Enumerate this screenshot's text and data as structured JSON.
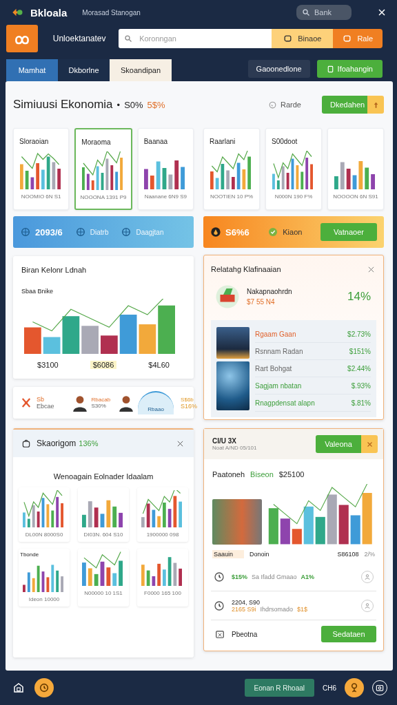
{
  "top_bar": {
    "app_name": "Bkloala",
    "subtitle": "Morasad Stanogan",
    "search": {
      "placeholder": "Bank"
    }
  },
  "header": {
    "title": "Unloektanatev",
    "search": {
      "placeholder": "Koronngan"
    },
    "buttons": [
      {
        "label": "Binaoe",
        "kind": "light"
      },
      {
        "label": "Rale",
        "kind": "accent"
      }
    ]
  },
  "tabs": [
    {
      "label": "Mamhat",
      "selected": true,
      "kind": "dark"
    },
    {
      "label": "Dkborlne",
      "selected": false,
      "kind": "dark"
    },
    {
      "label": "Skoandipan",
      "selected": false,
      "kind": "light"
    }
  ],
  "tab_actions": [
    {
      "label": "Gaoonedlone",
      "kind": "dark"
    },
    {
      "label": "Ifoahangin",
      "kind": "primary"
    }
  ],
  "page": {
    "title": "Simiuusi Ekonomia",
    "separator": "•",
    "stat": "S0%",
    "change": "5$%",
    "filter": "Rarde",
    "action": "Dkedahen"
  },
  "mini_charts": [
    {
      "title": "Sloraoian",
      "caption": "NOOMIO 6N S1",
      "selected": false
    },
    {
      "title": "Moraoma",
      "caption": "NOOONA 1391 P9",
      "selected": true
    },
    {
      "title": "Baanaa",
      "caption": "Naanane 6N9 S9",
      "selected": false
    },
    {
      "title": "Raarlani",
      "caption": "NOOTIEN 10 P%",
      "selected": false
    },
    {
      "title": "S00doot",
      "caption": "N000N 190 F%",
      "selected": false
    },
    {
      "caption": "NOOOON 6N S91",
      "selected": false
    }
  ],
  "blue_strip": {
    "items": [
      "2093/6",
      "Diatrb",
      "Daagjtan"
    ]
  },
  "orange_strip": {
    "items": [
      "S6%6",
      "Kiaon"
    ],
    "button": "Vatnaoer"
  },
  "sales_card": {
    "title": "Biran Kelonr Ldnah",
    "subtitle": "Sbaa Bnike",
    "totals": [
      "$3100",
      "$6086",
      "$4L60"
    ]
  },
  "people_card": {
    "label": "Sb",
    "caption": "Ebcae",
    "people": [
      {
        "name": "Rbacab",
        "value": "S30%"
      },
      {
        "name": "Rbaao"
      }
    ],
    "gauge": {
      "label": "S$6b",
      "value": "S16%"
    }
  },
  "ranking_card": {
    "title": "Relatahg Klafinaaian",
    "featured": {
      "name": "Nakapnaohrdn",
      "price": "$7 55 N4",
      "percent": "14%"
    },
    "rows": [
      {
        "label": "Rgaam Gaan",
        "value": "$2.73%",
        "kind": "orange"
      },
      {
        "label": "Rsnnam Radan",
        "value": "$151%",
        "kind": "muted"
      },
      {
        "label": "Rart Bohgat",
        "value": "$2.44%",
        "kind": "muted"
      },
      {
        "label": "Sagjam nbatan",
        "value": "$.93%",
        "kind": "green"
      },
      {
        "label": "Rnagpdensat alapn",
        "value": "$.81%",
        "kind": "green"
      }
    ]
  },
  "bottom_left": {
    "title": "Skaorigom",
    "stat": "136%",
    "subtitle": "Wenoagain Eolnader Idaalam",
    "side_label": "Tbonde",
    "charts": [
      "DL00N 8000S0",
      "DI03N. 604 S10",
      "1900000 098",
      "Ideon 10000",
      "N00000 10 1S1",
      "F0000 165 100"
    ]
  },
  "bottom_right": {
    "title": "CI/U 3X",
    "subtitle": "Noat A/ND 05/101",
    "button": "Valeona",
    "headline": "Paatoneh",
    "headline_tag": "Biseon",
    "headline_value": "$25100",
    "photo_caption": "Saauin",
    "chart_label": "Donoin",
    "chart_value": "S86108",
    "chart_pct": "2/%",
    "rows": [
      {
        "value": "$15%",
        "text": "Sa Ifadd Gmaao",
        "change": "A1%",
        "kind": "green"
      },
      {
        "title": "2204, S90",
        "value": "2165 S9i",
        "text": "Ihdrsomado",
        "change": "$1$",
        "kind": "orange"
      }
    ],
    "footer_label": "Pbeotna",
    "footer_button": "Sedataen"
  },
  "bottom_bar": {
    "button": "Eonan R Rhoaal",
    "label": "CH6"
  }
}
